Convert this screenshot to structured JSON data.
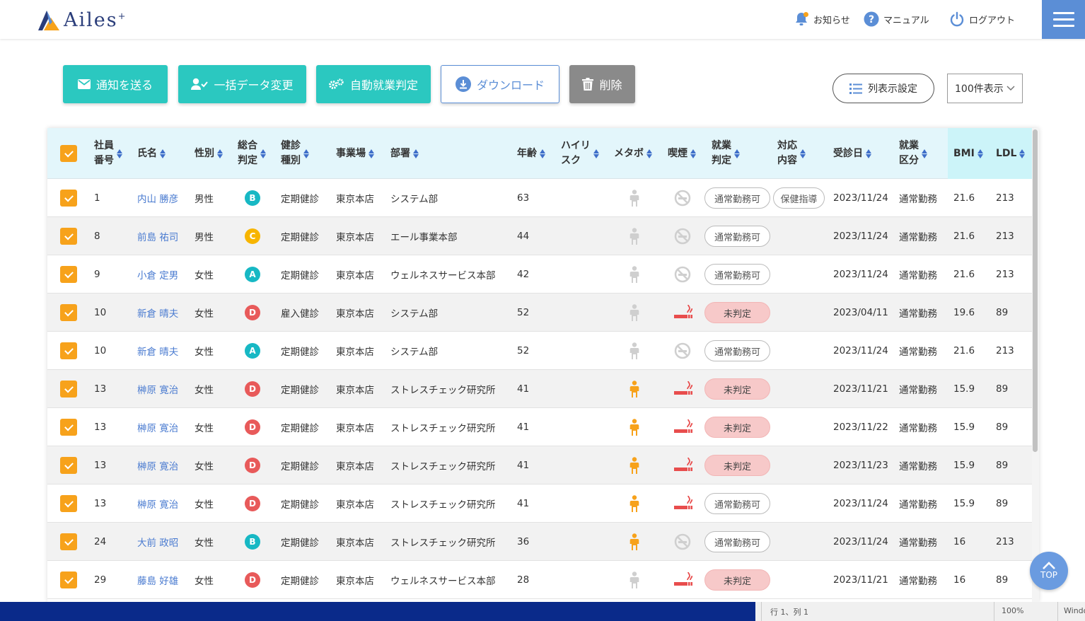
{
  "header": {
    "logo_text": "Ailes",
    "logo_sup": "+",
    "notice_label": "お知らせ",
    "manual_label": "マニュアル",
    "logout_label": "ログアウト"
  },
  "toolbar": {
    "notify_label": "通知を送る",
    "bulk_label": "一括データ変更",
    "auto_label": "自動就業判定",
    "download_label": "ダウンロード",
    "delete_label": "削除",
    "column_setting_label": "列表示設定",
    "per_page_value": "100件表示"
  },
  "columns": [
    {
      "key": "emp_no",
      "line1": "社員",
      "line2": "番号"
    },
    {
      "key": "name",
      "line1": "氏名",
      "line2": ""
    },
    {
      "key": "sex",
      "line1": "性別",
      "line2": ""
    },
    {
      "key": "total",
      "line1": "総合",
      "line2": "判定"
    },
    {
      "key": "exam_type",
      "line1": "健診",
      "line2": "種別"
    },
    {
      "key": "site",
      "line1": "事業場",
      "line2": ""
    },
    {
      "key": "dept",
      "line1": "部署",
      "line2": ""
    },
    {
      "key": "age",
      "line1": "年齢",
      "line2": ""
    },
    {
      "key": "highrisk",
      "line1": "ハイリ",
      "line2": "スク"
    },
    {
      "key": "metabo",
      "line1": "メタボ",
      "line2": ""
    },
    {
      "key": "smoke",
      "line1": "喫煙",
      "line2": ""
    },
    {
      "key": "work",
      "line1": "就業",
      "line2": "判定"
    },
    {
      "key": "action",
      "line1": "対応",
      "line2": "内容"
    },
    {
      "key": "date",
      "line1": "受診日",
      "line2": ""
    },
    {
      "key": "work_class",
      "line1": "就業",
      "line2": "区分"
    },
    {
      "key": "bmi",
      "line1": "BMI",
      "line2": ""
    },
    {
      "key": "ldl",
      "line1": "LDL",
      "line2": ""
    }
  ],
  "rows": [
    {
      "no": "1",
      "name": "内山 勝彦",
      "sex": "男性",
      "grade": "B",
      "exam": "定期健診",
      "site": "東京本店",
      "dept": "システム部",
      "age": "63",
      "metabo": false,
      "smoker": false,
      "work": "通常勤務可",
      "work_pending": false,
      "action": "保健指導",
      "date": "2023/11/24",
      "work_class": "通常勤務",
      "bmi": "21.6",
      "ldl": "213"
    },
    {
      "no": "8",
      "name": "前島 祐司",
      "sex": "男性",
      "grade": "C",
      "exam": "定期健診",
      "site": "東京本店",
      "dept": "エール事業本部",
      "age": "44",
      "metabo": false,
      "smoker": false,
      "work": "通常勤務可",
      "work_pending": false,
      "action": "",
      "date": "2023/11/24",
      "work_class": "通常勤務",
      "bmi": "21.6",
      "ldl": "213"
    },
    {
      "no": "9",
      "name": "小倉 定男",
      "sex": "女性",
      "grade": "A",
      "exam": "定期健診",
      "site": "東京本店",
      "dept": "ウェルネスサービス本部",
      "age": "42",
      "metabo": false,
      "smoker": false,
      "work": "通常勤務可",
      "work_pending": false,
      "action": "",
      "date": "2023/11/24",
      "work_class": "通常勤務",
      "bmi": "21.6",
      "ldl": "213"
    },
    {
      "no": "10",
      "name": "新倉 晴夫",
      "sex": "女性",
      "grade": "D",
      "exam": "雇入健診",
      "site": "東京本店",
      "dept": "システム部",
      "age": "52",
      "metabo": false,
      "smoker": true,
      "work": "未判定",
      "work_pending": true,
      "action": "",
      "date": "2023/04/11",
      "work_class": "通常勤務",
      "bmi": "19.6",
      "ldl": "89"
    },
    {
      "no": "10",
      "name": "新倉 晴夫",
      "sex": "女性",
      "grade": "A",
      "exam": "定期健診",
      "site": "東京本店",
      "dept": "システム部",
      "age": "52",
      "metabo": false,
      "smoker": false,
      "work": "通常勤務可",
      "work_pending": false,
      "action": "",
      "date": "2023/11/24",
      "work_class": "通常勤務",
      "bmi": "21.6",
      "ldl": "213"
    },
    {
      "no": "13",
      "name": "榊原 寛治",
      "sex": "女性",
      "grade": "D",
      "exam": "定期健診",
      "site": "東京本店",
      "dept": "ストレスチェック研究所",
      "age": "41",
      "metabo": true,
      "smoker": true,
      "work": "未判定",
      "work_pending": true,
      "action": "",
      "date": "2023/11/21",
      "work_class": "通常勤務",
      "bmi": "15.9",
      "ldl": "89"
    },
    {
      "no": "13",
      "name": "榊原 寛治",
      "sex": "女性",
      "grade": "D",
      "exam": "定期健診",
      "site": "東京本店",
      "dept": "ストレスチェック研究所",
      "age": "41",
      "metabo": true,
      "smoker": true,
      "work": "未判定",
      "work_pending": true,
      "action": "",
      "date": "2023/11/22",
      "work_class": "通常勤務",
      "bmi": "15.9",
      "ldl": "89"
    },
    {
      "no": "13",
      "name": "榊原 寛治",
      "sex": "女性",
      "grade": "D",
      "exam": "定期健診",
      "site": "東京本店",
      "dept": "ストレスチェック研究所",
      "age": "41",
      "metabo": true,
      "smoker": true,
      "work": "未判定",
      "work_pending": true,
      "action": "",
      "date": "2023/11/23",
      "work_class": "通常勤務",
      "bmi": "15.9",
      "ldl": "89"
    },
    {
      "no": "13",
      "name": "榊原 寛治",
      "sex": "女性",
      "grade": "D",
      "exam": "定期健診",
      "site": "東京本店",
      "dept": "ストレスチェック研究所",
      "age": "41",
      "metabo": true,
      "smoker": true,
      "work": "通常勤務可",
      "work_pending": false,
      "action": "",
      "date": "2023/11/24",
      "work_class": "通常勤務",
      "bmi": "15.9",
      "ldl": "89"
    },
    {
      "no": "24",
      "name": "大前 政昭",
      "sex": "女性",
      "grade": "B",
      "exam": "定期健診",
      "site": "東京本店",
      "dept": "ストレスチェック研究所",
      "age": "36",
      "metabo": true,
      "smoker": false,
      "work": "通常勤務可",
      "work_pending": false,
      "action": "",
      "date": "2023/11/24",
      "work_class": "通常勤務",
      "bmi": "16",
      "ldl": "213"
    },
    {
      "no": "29",
      "name": "藤島 好雄",
      "sex": "女性",
      "grade": "D",
      "exam": "定期健診",
      "site": "東京本店",
      "dept": "ウェルネスサービス本部",
      "age": "28",
      "metabo": false,
      "smoker": true,
      "work": "未判定",
      "work_pending": true,
      "action": "",
      "date": "2023/11/21",
      "work_class": "通常勤務",
      "bmi": "16",
      "ldl": "89"
    }
  ],
  "grade_colors": {
    "A": "#17b8c4",
    "B": "#17b8c4",
    "C": "#f7b500",
    "D": "#e85a5a"
  },
  "colors": {
    "accent_teal": "#2bc8c0",
    "accent_blue": "#5b8ed6",
    "checkbox": "#f7a21b",
    "metabo_on": "#f7a21b",
    "smoker": "#e84d4d"
  },
  "top_button_label": "TOP",
  "statusbar": {
    "position": "行 1、列 1",
    "zoom": "100%",
    "os": "Windo"
  }
}
